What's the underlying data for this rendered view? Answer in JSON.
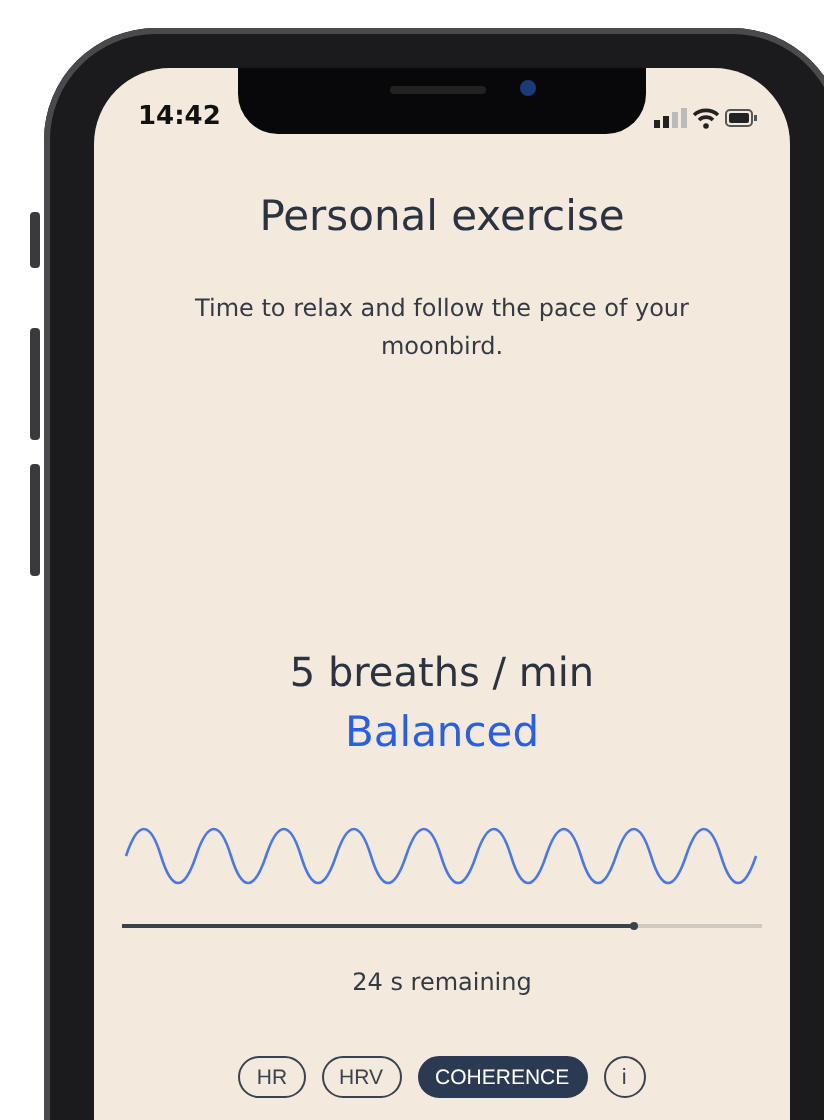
{
  "status_bar": {
    "time": "14:42"
  },
  "title": "Personal exercise",
  "subtitle": "Time to relax and follow the pace of your moonbird.",
  "pace": "5 breaths / min",
  "mode": "Balanced",
  "progress": {
    "level": 0.8
  },
  "remaining": "24 s remaining",
  "chips": [
    {
      "label": "HR",
      "selected": false
    },
    {
      "label": "HRV",
      "selected": false
    },
    {
      "label": "COHERENCE",
      "selected": true
    }
  ],
  "info_button": "i"
}
